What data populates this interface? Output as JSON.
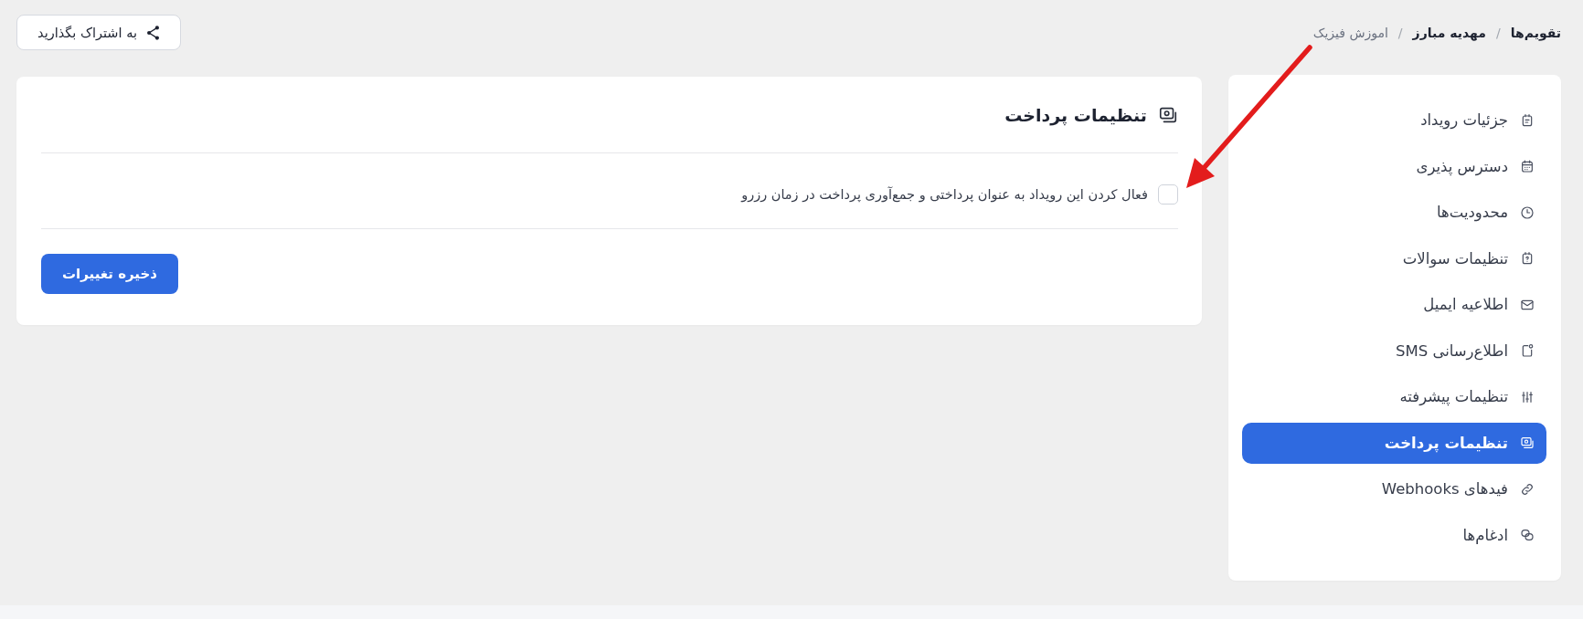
{
  "breadcrumb": {
    "items": [
      {
        "label": "تقویم‌ها",
        "current": false
      },
      {
        "label": "مهدیه مبارز",
        "current": false
      },
      {
        "label": "اموزش فیزیک",
        "current": true
      }
    ],
    "separators": [
      "/",
      "/"
    ]
  },
  "share_button": {
    "label": "به اشتراک بگذارید"
  },
  "sidebar": {
    "items": [
      {
        "label": "جزئیات رویداد",
        "selected": false
      },
      {
        "label": "دسترس پذیری",
        "selected": false
      },
      {
        "label": "محدودیت‌ها",
        "selected": false
      },
      {
        "label": "تنظیمات سوالات",
        "selected": false
      },
      {
        "label": "اطلاعیه ایمیل",
        "selected": false
      },
      {
        "label": "اطلاع‌رسانی SMS",
        "selected": false
      },
      {
        "label": "تنظیمات پیشرفته",
        "selected": false
      },
      {
        "label": "تنظیمات پرداخت",
        "selected": true
      },
      {
        "label": "فیدهای Webhooks",
        "selected": false
      },
      {
        "label": "ادغام‌ها",
        "selected": false
      }
    ]
  },
  "panel": {
    "title": "تنظیمات پرداخت",
    "options": [
      {
        "kind": "checkbox",
        "label": "فعال کردن این رویداد به عنوان پرداختی و جمع‌آوری پرداخت در زمان رزرو",
        "checked": false
      }
    ],
    "save_button": {
      "label": "ذخیره تغییرات"
    }
  }
}
